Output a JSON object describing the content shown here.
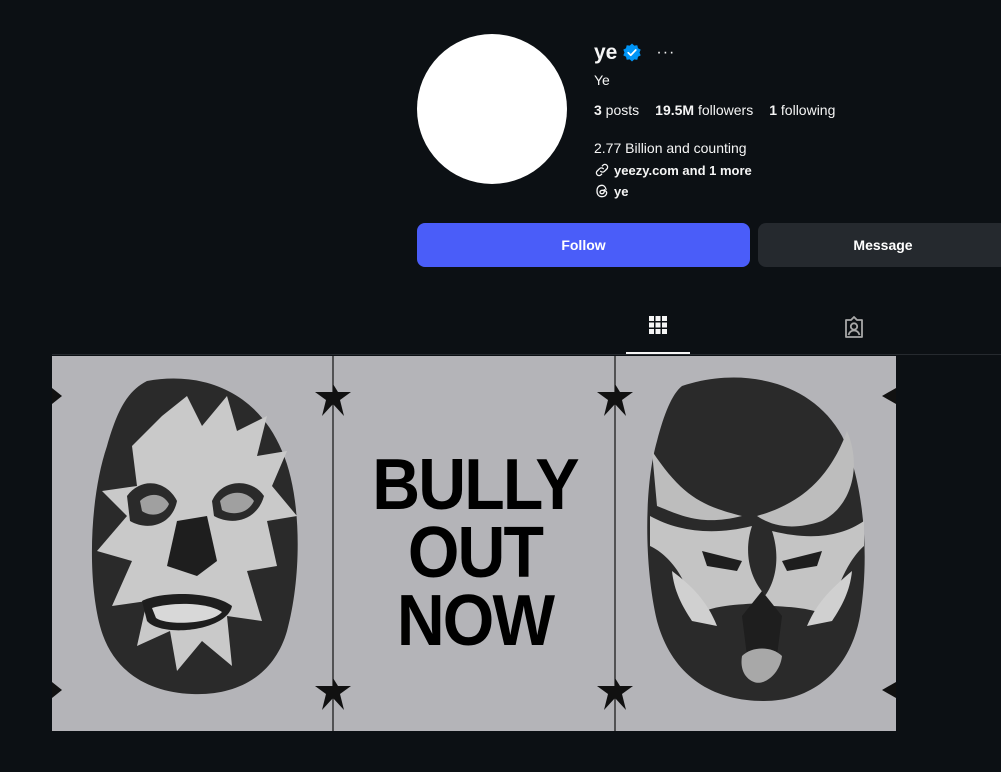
{
  "profile": {
    "username": "ye",
    "full_name": "Ye",
    "verified": true,
    "more_label": "···",
    "avatar_color": "#ffffff"
  },
  "stats": {
    "posts_count": "3",
    "posts_label": " posts",
    "followers_count": "19.5M",
    "followers_label": " followers",
    "following_count": "1",
    "following_label": " following"
  },
  "bio": {
    "text": "2.77 Billion and counting",
    "link_text": "yeezy.com and 1 more",
    "threads_handle": "ye"
  },
  "actions": {
    "follow_label": "Follow",
    "message_label": "Message"
  },
  "tabs": [
    {
      "icon": "grid-icon",
      "active": true
    },
    {
      "icon": "tagged-icon",
      "active": false
    }
  ],
  "post": {
    "text": "BULLY\nOUT\nNOW",
    "background": "#b4b4b8"
  },
  "colors": {
    "background": "#0c1014",
    "follow_button": "#4a5df9",
    "message_button": "#25292e",
    "verified_badge": "#0095f6"
  }
}
